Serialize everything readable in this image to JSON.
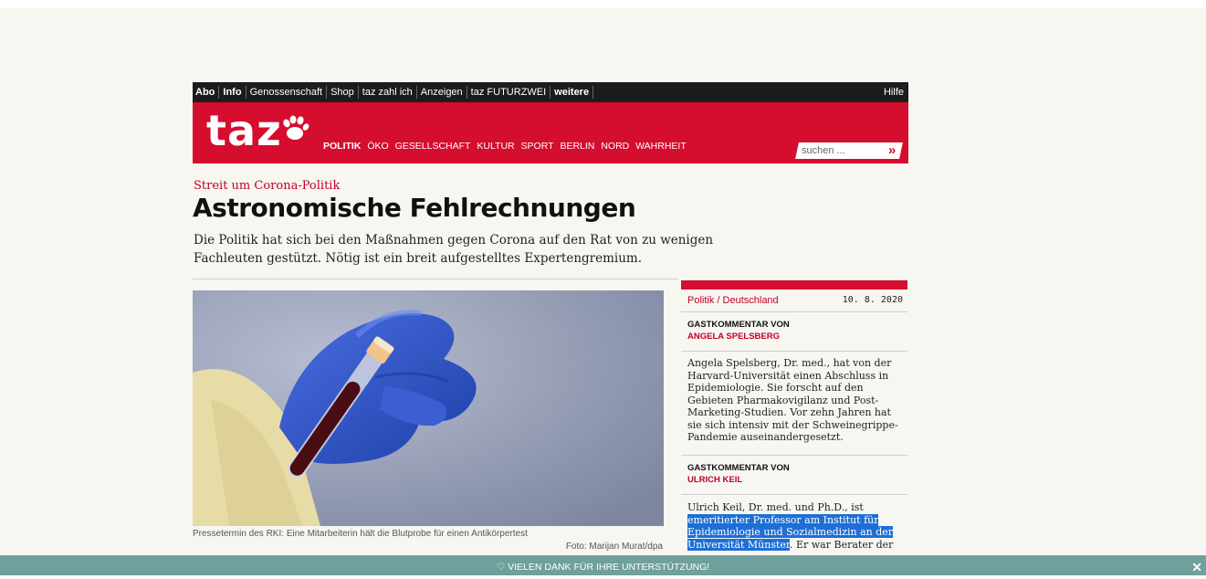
{
  "topbar": {
    "items": [
      "Abo",
      "Info",
      "Genossenschaft",
      "Shop",
      "taz zahl ich",
      "Anzeigen",
      "taz FUTURZWEI",
      "weitere"
    ],
    "help": "Hilfe"
  },
  "header": {
    "logo": "taz",
    "nav": [
      "POLITIK",
      "ÖKO",
      "GESELLSCHAFT",
      "KULTUR",
      "SPORT",
      "BERLIN",
      "NORD",
      "WAHRHEIT"
    ],
    "search_placeholder": "suchen ...",
    "search_go": "»"
  },
  "article": {
    "kicker": "Streit um Corona-Politik",
    "headline": "Astronomische Fehlrechnungen",
    "lead": "Die Politik hat sich bei den Maßnahmen gegen Corona auf den Rat von zu wenigen Fachleuten gestützt. Nötig ist ein breit aufgestelltes Expertengremium.",
    "caption": "Pressetermin des RKI: Eine Mitarbeiterin hält die Blutprobe für einen Antikörpertest",
    "credit": "Foto: Marijan Murat/dpa"
  },
  "sidebar": {
    "category": "Politik",
    "subcategory": "Deutschland",
    "date": "10. 8. 2020",
    "authors": [
      {
        "label": "Gastkommentar von",
        "name": "Angela Spelsberg",
        "bio": "Angela Spelsberg, Dr. med., hat von der Harvard-Universität einen Abschluss in Epidemiologie. Sie forscht auf den Gebieten Pharmakovigilanz und Post-Marketing-Studien. Vor zehn Jahren hat sie sich intensiv mit der Schweinegrippe-Pandemie auseinandergesetzt."
      },
      {
        "label": "Gastkommentar von",
        "name": "Ulrich Keil",
        "bio_pre": "Ulrich Keil, Dr. med. und Ph.D., ist",
        "bio_highlight": "emeritierter Professor am Institut für Epidemiologie und Sozialmedizin an der Universität Münster",
        "bio_post": ". Er war Berater der"
      }
    ]
  },
  "banner": {
    "text": "♡ Vielen Dank für Ihre Unterstützung!",
    "close": "✕"
  },
  "colors": {
    "brand_red": "#d50d2e",
    "banner_teal": "#6fa09b",
    "highlight_blue": "#1d6fd6"
  }
}
